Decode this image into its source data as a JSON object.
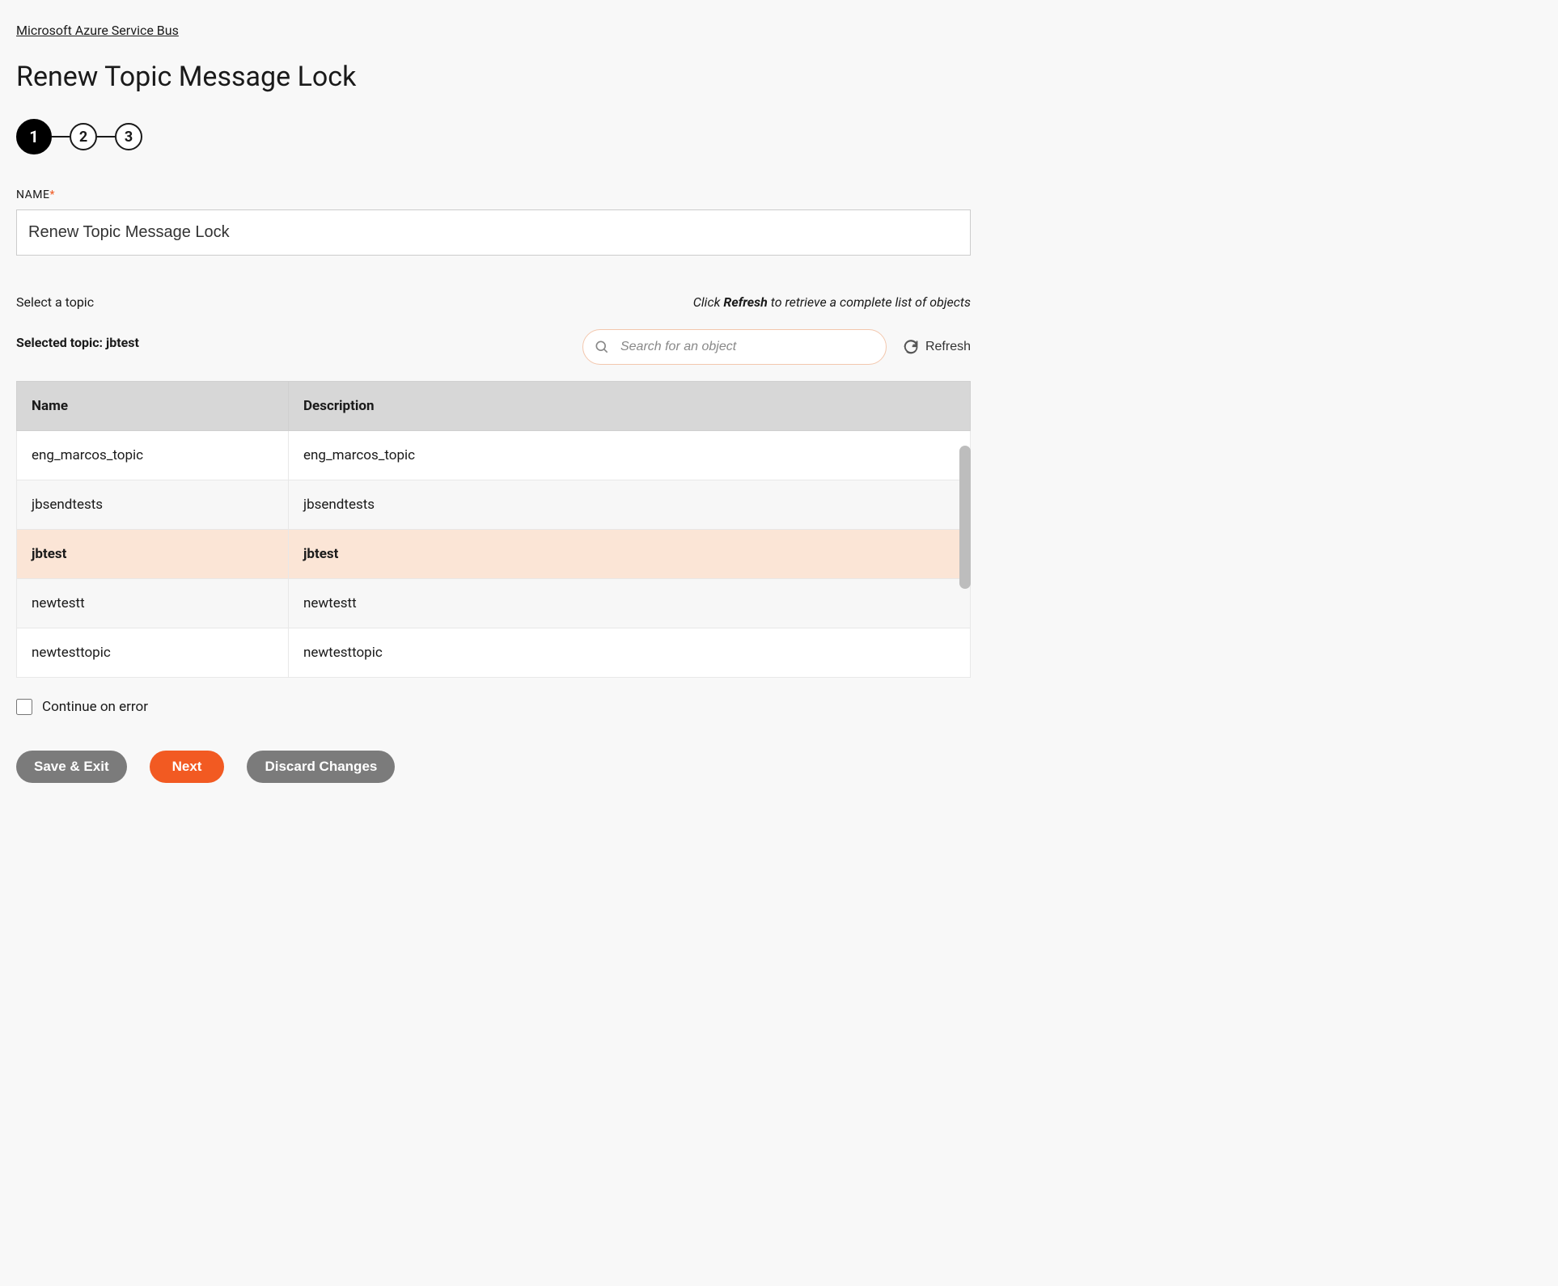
{
  "breadcrumb": {
    "label": "Microsoft Azure Service Bus"
  },
  "page": {
    "title": "Renew Topic Message Lock"
  },
  "stepper": {
    "steps": [
      "1",
      "2",
      "3"
    ],
    "active_index": 0
  },
  "name_field": {
    "label": "NAME",
    "required_mark": "*",
    "value": "Renew Topic Message Lock"
  },
  "topic_section": {
    "select_label": "Select a topic",
    "hint_prefix": "Click ",
    "hint_bold": "Refresh",
    "hint_suffix": " to retrieve a complete list of objects",
    "selected_prefix": "Selected topic: ",
    "selected_value": "jbtest",
    "search_placeholder": "Search for an object",
    "refresh_label": "Refresh"
  },
  "table": {
    "headers": {
      "name": "Name",
      "description": "Description"
    },
    "rows": [
      {
        "name": "eng_marcos_topic",
        "description": "eng_marcos_topic",
        "selected": false
      },
      {
        "name": "jbsendtests",
        "description": "jbsendtests",
        "selected": false
      },
      {
        "name": "jbtest",
        "description": "jbtest",
        "selected": true
      },
      {
        "name": "newtestt",
        "description": "newtestt",
        "selected": false
      },
      {
        "name": "newtesttopic",
        "description": "newtesttopic",
        "selected": false
      }
    ]
  },
  "continue_on_error": {
    "label": "Continue on error",
    "checked": false
  },
  "buttons": {
    "save_exit": "Save & Exit",
    "next": "Next",
    "discard": "Discard Changes"
  },
  "colors": {
    "accent": "#f25a22",
    "selected_row": "#fbe5d6"
  }
}
